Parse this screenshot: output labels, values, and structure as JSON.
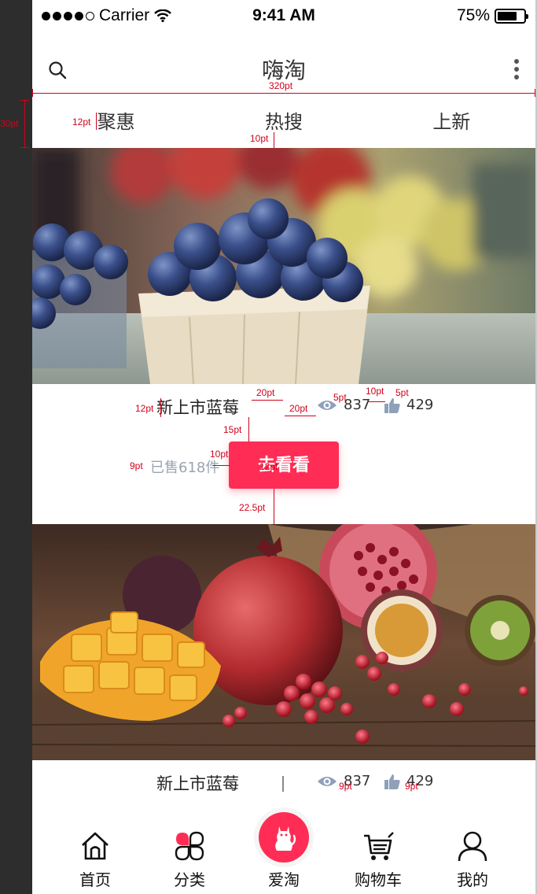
{
  "status_bar": {
    "carrier": "Carrier",
    "time": "9:41 AM",
    "battery": "75%"
  },
  "header": {
    "title": "嗨淘"
  },
  "tabs": [
    {
      "label": "聚惠"
    },
    {
      "label": "热搜"
    },
    {
      "label": "上新"
    }
  ],
  "products": [
    {
      "name": "新上市蓝莓",
      "views": "837",
      "likes": "429",
      "sold": "已售618件",
      "cta": "去看看",
      "image": "blueberries"
    },
    {
      "name": "新上市蓝莓",
      "views": "837",
      "likes": "429",
      "image": "pomegranate-mango"
    }
  ],
  "tab_bar": [
    {
      "label": "首页",
      "icon": "home-icon"
    },
    {
      "label": "分类",
      "icon": "category-icon"
    },
    {
      "label": "爱淘",
      "icon": "cat-icon"
    },
    {
      "label": "购物车",
      "icon": "cart-icon"
    },
    {
      "label": "我的",
      "icon": "user-icon"
    }
  ],
  "annotations": {
    "width": "320pt",
    "tab_height": "30pt",
    "tab_left": "12pt",
    "tab_gap": "10pt",
    "name_left": "12pt",
    "name_gap": "20pt",
    "sep_gap": "20pt",
    "icon_gap": "5pt",
    "likes_gap": "10pt",
    "likes_icon_gap": "5pt",
    "btn_top": "15pt",
    "sold_left": "9pt",
    "sold_gap": "10pt",
    "btn_inner": "12pt",
    "btn_bottom": "22.5pt",
    "icon_v1": "9pt",
    "icon_v2": "9pt"
  },
  "colors": {
    "accent": "#ff2d55",
    "annotation": "#d0021b",
    "muted": "#9aa4b0"
  }
}
